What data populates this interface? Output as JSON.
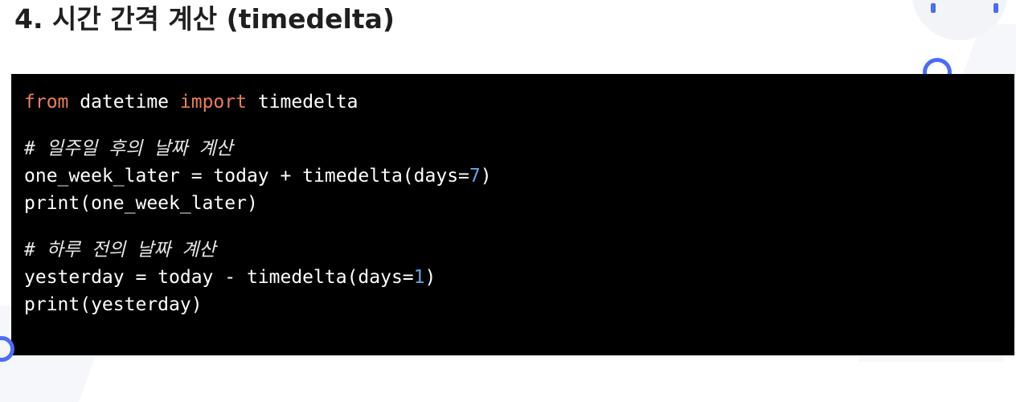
{
  "title": "4. 시간 간격 계산 (timedelta)",
  "code": {
    "line1": {
      "kw1": "from",
      "t1": " datetime ",
      "kw2": "import",
      "t2": " timedelta"
    },
    "comment1": "# 일주일 후의 날짜 계산",
    "line3": {
      "t1": "one_week_later = today + timedelta(days=",
      "num": "7",
      "t2": ")"
    },
    "line4": "print(one_week_later)",
    "comment2": "# 하루 전의 날짜 계산",
    "line6": {
      "t1": "yesterday = today - timedelta(days=",
      "num": "1",
      "t2": ")"
    },
    "line7": "print(yesterday)"
  },
  "colors": {
    "keyword": "#e87f5a",
    "number": "#5ca7e6",
    "code_bg": "#000000",
    "accent": "#4a6cf7"
  }
}
